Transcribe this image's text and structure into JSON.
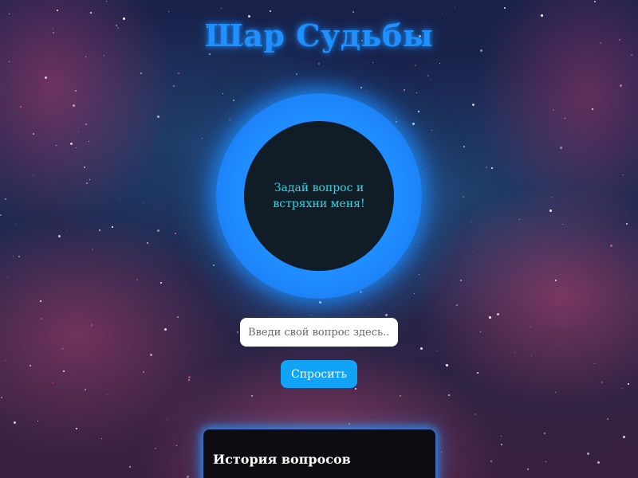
{
  "app": {
    "title": "Шар Судьбы"
  },
  "ball": {
    "message": "Задай вопрос и встряхни меня!"
  },
  "form": {
    "input_placeholder": "Введи свой вопрос здесь...",
    "input_value": "",
    "ask_label": "Спросить"
  },
  "history": {
    "title": "История вопросов"
  },
  "colors": {
    "accent": "#1e90ff",
    "ball_text": "#34d6e6",
    "button": "#11a3f5",
    "ball_center": "#101d26"
  }
}
